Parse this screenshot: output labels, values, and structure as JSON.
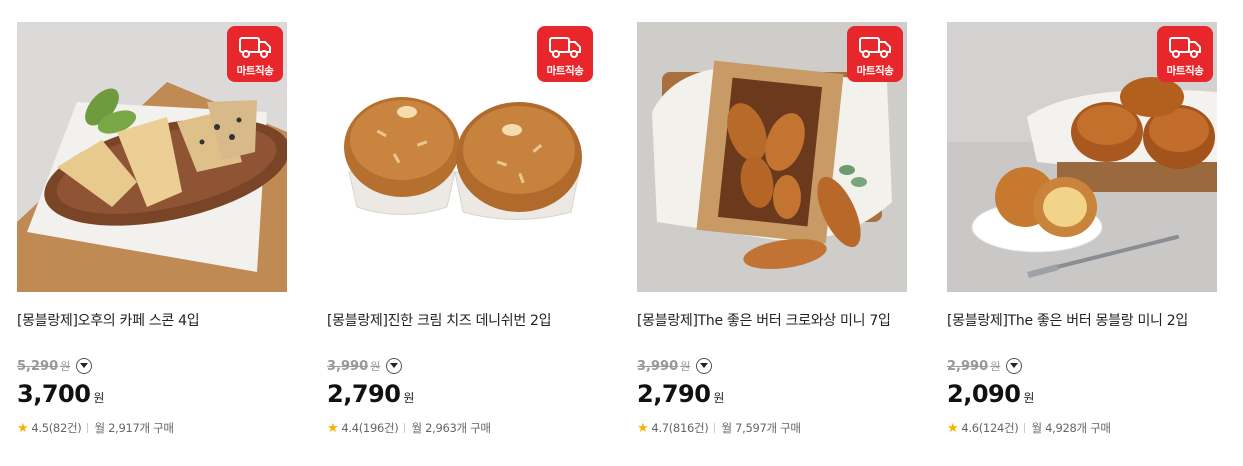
{
  "products": [
    {
      "badge": "마트직송",
      "title": "[몽블랑제]오후의 카페 스콘 4입",
      "original_price": "5,290",
      "original_unit": "원",
      "price": "3,700",
      "price_unit": "원",
      "rating": "4.5(82건)",
      "monthly_sales": "월 2,917개 구매"
    },
    {
      "badge": "마트직송",
      "title": "[몽블랑제]진한 크림 치즈 데니쉬번 2입",
      "original_price": "3,990",
      "original_unit": "원",
      "price": "2,790",
      "price_unit": "원",
      "rating": "4.4(196건)",
      "monthly_sales": "월 2,963개 구매"
    },
    {
      "badge": "마트직송",
      "title": "[몽블랑제]The 좋은 버터 크로와상 미니 7입",
      "original_price": "3,990",
      "original_unit": "원",
      "price": "2,790",
      "price_unit": "원",
      "rating": "4.7(816건)",
      "monthly_sales": "월 7,597개 구매"
    },
    {
      "badge": "마트직송",
      "title": "[몽블랑제]The 좋은 버터 몽블랑 미니 2입",
      "original_price": "2,990",
      "original_unit": "원",
      "price": "2,090",
      "price_unit": "원",
      "rating": "4.6(124건)",
      "monthly_sales": "월 4,928개 구매"
    }
  ],
  "colors": {
    "badge": "#e8272c",
    "star": "#f5b301"
  },
  "icons": {
    "badge": "delivery-truck-icon",
    "rating": "star-icon",
    "price_info": "chevron-down-icon"
  }
}
